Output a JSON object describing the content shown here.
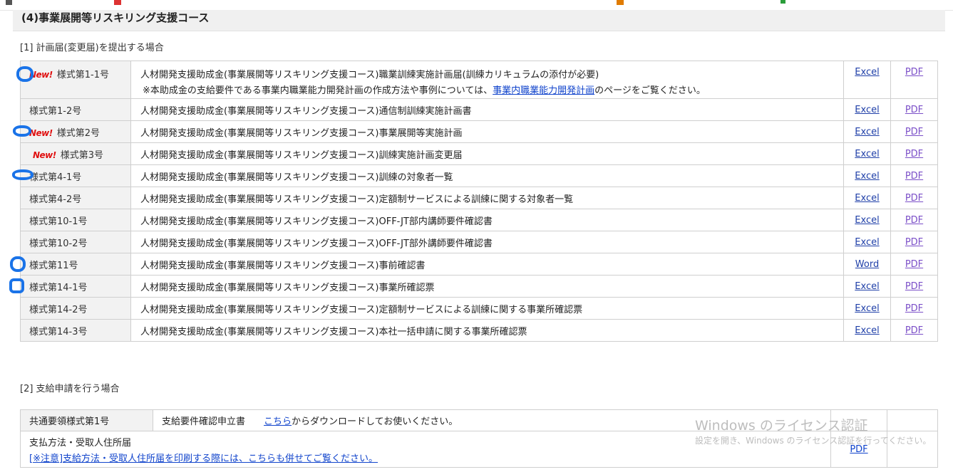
{
  "section_title": "(4)事業展開等リスキリング支援コース",
  "part1_heading": "[1] 計画届(変更届)を提出する場合",
  "new_label": "New!",
  "forms": [
    {
      "code": "様式第1-1号",
      "desc": "人材開発支援助成金(事業展開等リスキリング支援コース)職業訓練実施計画届(訓練カリキュラムの添付が必要)",
      "link1": "Excel",
      "link2": "PDF"
    },
    {
      "code": "様式第1-2号",
      "desc": "人材開発支援助成金(事業展開等リスキリング支援コース)通信制訓練実施計画書",
      "link1": "Excel",
      "link2": "PDF"
    },
    {
      "code": "様式第2号",
      "desc": "人材開発支援助成金(事業展開等リスキリング支援コース)事業展開等実施計画",
      "link1": "Excel",
      "link2": "PDF"
    },
    {
      "code": "様式第3号",
      "desc": "人材開発支援助成金(事業展開等リスキリング支援コース)訓練実施計画変更届",
      "link1": "Excel",
      "link2": "PDF"
    },
    {
      "code": "様式第4-1号",
      "desc": "人材開発支援助成金(事業展開等リスキリング支援コース)訓練の対象者一覧",
      "link1": "Excel",
      "link2": "PDF"
    },
    {
      "code": "様式第4-2号",
      "desc": "人材開発支援助成金(事業展開等リスキリング支援コース)定額制サービスによる訓練に関する対象者一覧",
      "link1": "Excel",
      "link2": "PDF"
    },
    {
      "code": "様式第10-1号",
      "desc": "人材開発支援助成金(事業展開等リスキリング支援コース)OFF-JT部内講師要件確認書",
      "link1": "Excel",
      "link2": "PDF"
    },
    {
      "code": "様式第10-2号",
      "desc": "人材開発支援助成金(事業展開等リスキリング支援コース)OFF-JT部外講師要件確認書",
      "link1": "Excel",
      "link2": "PDF"
    },
    {
      "code": "様式第11号",
      "desc": "人材開発支援助成金(事業展開等リスキリング支援コース)事前確認書",
      "link1": "Word",
      "link2": "PDF"
    },
    {
      "code": "様式第14-1号",
      "desc": "人材開発支援助成金(事業展開等リスキリング支援コース)事業所確認票",
      "link1": "Excel",
      "link2": "PDF"
    },
    {
      "code": "様式第14-2号",
      "desc": "人材開発支援助成金(事業展開等リスキリング支援コース)定額制サービスによる訓練に関する事業所確認票",
      "link1": "Excel",
      "link2": "PDF"
    },
    {
      "code": "様式第14-3号",
      "desc": "人材開発支援助成金(事業展開等リスキリング支援コース)本社一括申請に関する事業所確認票",
      "link1": "Excel",
      "link2": "PDF"
    }
  ],
  "note_prefix": "※本助成金の支給要件である事業内職業能力開発計画の作成方法や事例については、",
  "note_link": "事業内職業能力開発計画",
  "note_suffix": "のページをご覧ください。",
  "part2_heading": "[2] 支給申請を行う場合",
  "payment": {
    "row1_code": "共通要領様式第1号",
    "row1_name": "支給要件確認申立書",
    "row1_link": "こちら",
    "row1_suffix": "からダウンロードしてお使いください。",
    "row2_label": "支払方法・受取人住所届",
    "row2_note_link": "[※注意]支給方法・受取人住所届を印刷する際には、こちらも併せてご覧ください。",
    "row2_pdf": "PDF"
  },
  "watermark_title": "Windows のライセンス認証",
  "watermark_sub": "設定を開き、Windows のライセンス認証を行ってください。",
  "colors": {
    "annotation": "#1a73e8",
    "new_badge": "#e01010",
    "header_bg": "#f0f0f0"
  }
}
